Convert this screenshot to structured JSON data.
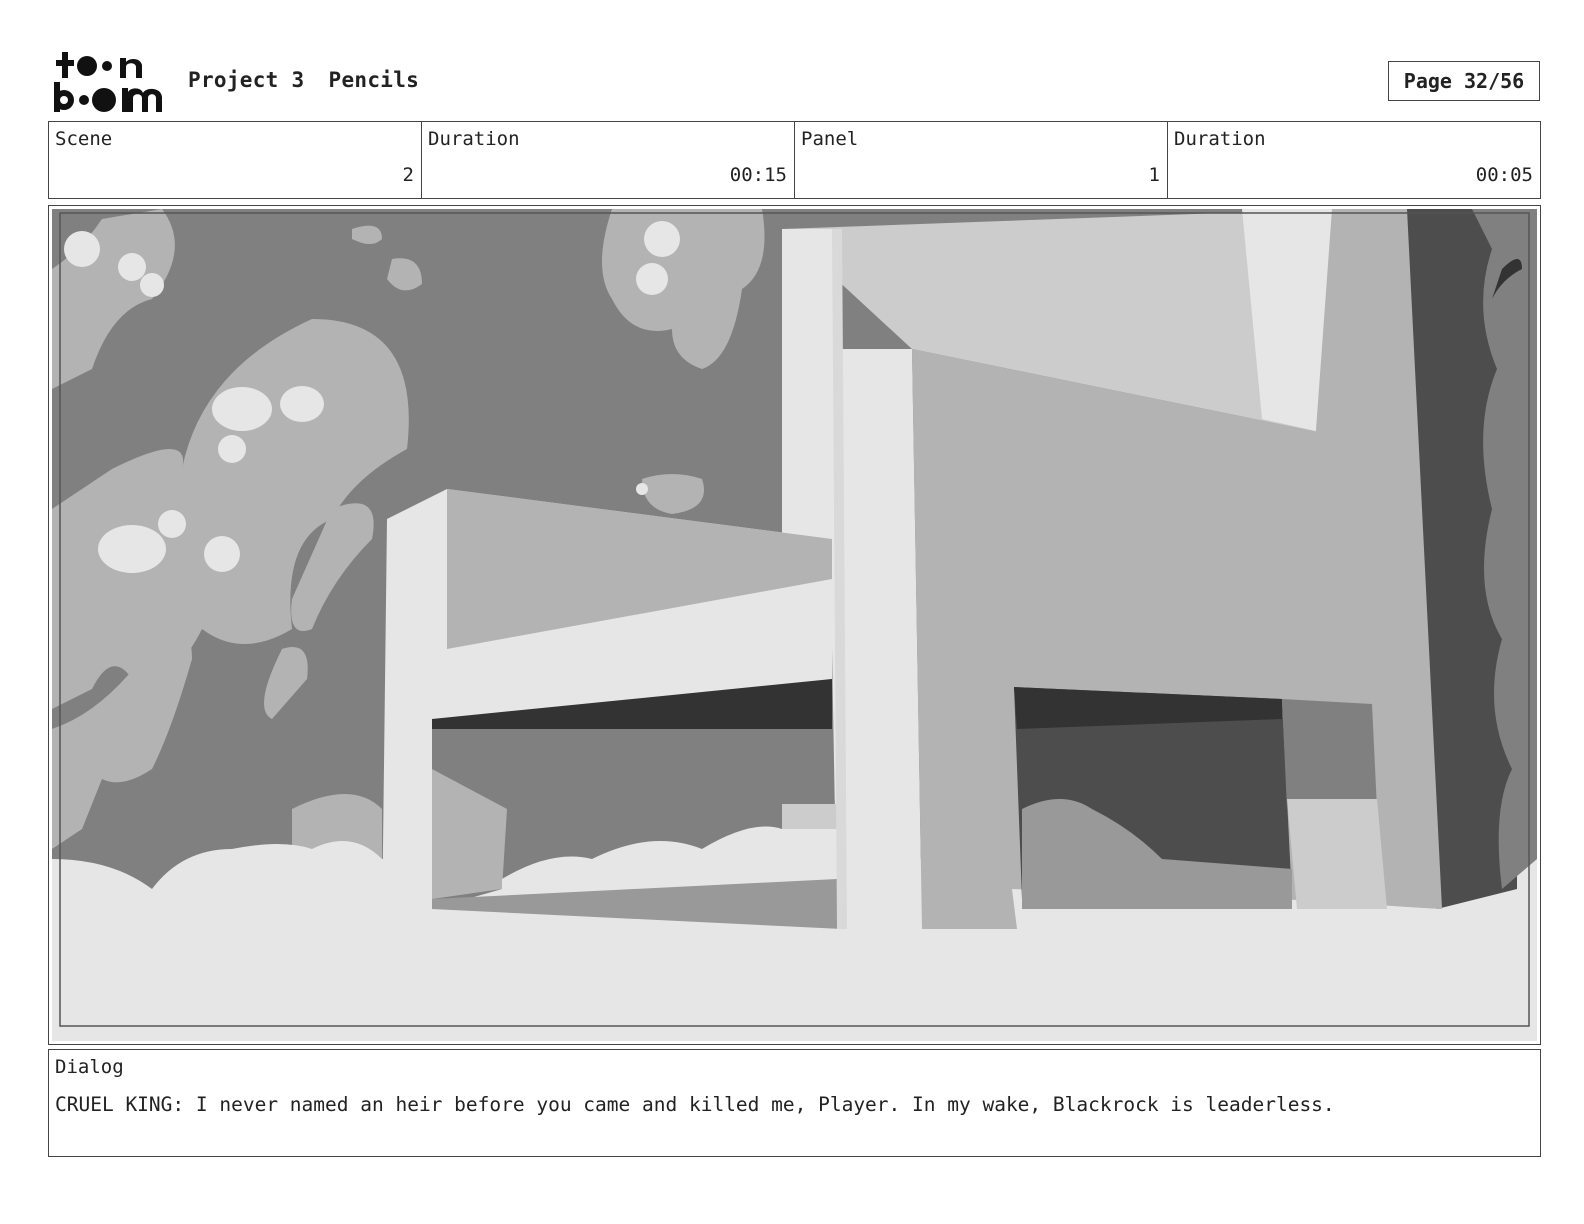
{
  "header": {
    "logo_text": "toon boom",
    "project": "Project 3",
    "stage": "Pencils",
    "page": "Page 32/56"
  },
  "info": {
    "scene_label": "Scene",
    "scene_value": "2",
    "scene_duration_label": "Duration",
    "scene_duration_value": "00:15",
    "panel_label": "Panel",
    "panel_value": "1",
    "panel_duration_label": "Duration",
    "panel_duration_value": "00:05"
  },
  "dialog": {
    "label": "Dialog",
    "text": "CRUEL KING: I never named an heir before you came and killed me, Player. In my wake, Blackrock is leaderless."
  },
  "colors": {
    "sky": "#808080",
    "light": "#e6e6e6",
    "mid": "#b3b3b3",
    "dark": "#4d4d4d",
    "darker": "#333333"
  }
}
